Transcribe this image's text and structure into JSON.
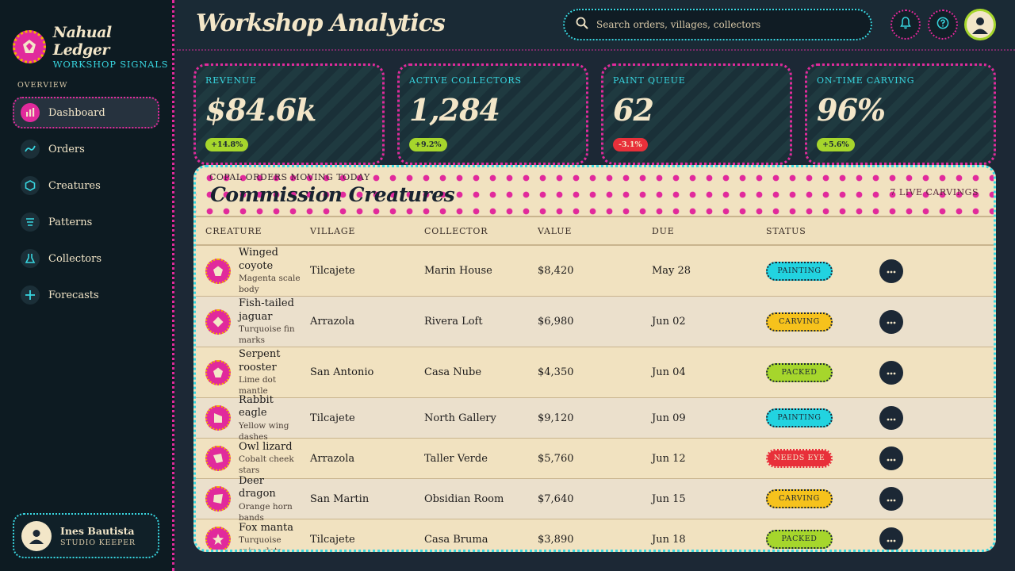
{
  "brand": {
    "name": "Nahual Ledger",
    "subtitle": "WORKSHOP SIGNALS"
  },
  "sidebar": {
    "section": "OVERVIEW",
    "items": [
      {
        "label": "Dashboard",
        "icon": "bar-chart-icon"
      },
      {
        "label": "Orders",
        "icon": "trend-line-icon"
      },
      {
        "label": "Creatures",
        "icon": "hexagon-icon"
      },
      {
        "label": "Patterns",
        "icon": "lines-icon"
      },
      {
        "label": "Collectors",
        "icon": "flask-icon"
      },
      {
        "label": "Forecasts",
        "icon": "plus-icon"
      }
    ],
    "user": {
      "name": "Ines Bautista",
      "role": "STUDIO KEEPER"
    }
  },
  "header": {
    "title": "Workshop Analytics",
    "search_placeholder": "Search orders, villages, collectors"
  },
  "stats": [
    {
      "label": "REVENUE",
      "value": "$84.6k",
      "delta": "+14.8%",
      "direction": "up"
    },
    {
      "label": "ACTIVE COLLECTORS",
      "value": "1,284",
      "delta": "+9.2%",
      "direction": "up"
    },
    {
      "label": "PAINT QUEUE",
      "value": "62",
      "delta": "-3.1%",
      "direction": "down"
    },
    {
      "label": "ON-TIME CARVING",
      "value": "96%",
      "delta": "+5.6%",
      "direction": "up"
    }
  ],
  "table": {
    "kicker": "COPAL ORDERS MOVING TODAY",
    "title": "Commission Creatures",
    "count": "7 LIVE CARVINGS",
    "columns": [
      "CREATURE",
      "VILLAGE",
      "COLLECTOR",
      "VALUE",
      "DUE",
      "STATUS"
    ],
    "rows": [
      {
        "name": "Winged coyote",
        "desc": "Magenta scale body",
        "village": "Tilcajete",
        "collector": "Marin House",
        "value": "$8,420",
        "due": "May 28",
        "status": "PAINTING",
        "status_kind": "painting"
      },
      {
        "name": "Fish-tailed jaguar",
        "desc": "Turquoise fin marks",
        "village": "Arrazola",
        "collector": "Rivera Loft",
        "value": "$6,980",
        "due": "Jun 02",
        "status": "CARVING",
        "status_kind": "carving"
      },
      {
        "name": "Serpent rooster",
        "desc": "Lime dot mantle",
        "village": "San Antonio",
        "collector": "Casa Nube",
        "value": "$4,350",
        "due": "Jun 04",
        "status": "PACKED",
        "status_kind": "packed"
      },
      {
        "name": "Rabbit eagle",
        "desc": "Yellow wing dashes",
        "village": "Tilcajete",
        "collector": "North Gallery",
        "value": "$9,120",
        "due": "Jun 09",
        "status": "PAINTING",
        "status_kind": "painting"
      },
      {
        "name": "Owl lizard",
        "desc": "Cobalt cheek stars",
        "village": "Arrazola",
        "collector": "Taller Verde",
        "value": "$5,760",
        "due": "Jun 12",
        "status": "NEEDS EYE",
        "status_kind": "needs"
      },
      {
        "name": "Deer dragon",
        "desc": "Orange horn bands",
        "village": "San Martin",
        "collector": "Obsidian Room",
        "value": "$7,640",
        "due": "Jun 15",
        "status": "CARVING",
        "status_kind": "carving"
      },
      {
        "name": "Fox manta",
        "desc": "Turquoise spine dots",
        "village": "Tilcajete",
        "collector": "Casa Bruma",
        "value": "$3,890",
        "due": "Jun 18",
        "status": "PACKED",
        "status_kind": "packed"
      }
    ]
  },
  "colors": {
    "accent": "#e12a9c",
    "cyan": "#38d6e0",
    "lime": "#a6d62c",
    "yellow": "#f6c21c",
    "red": "#e8303a"
  }
}
